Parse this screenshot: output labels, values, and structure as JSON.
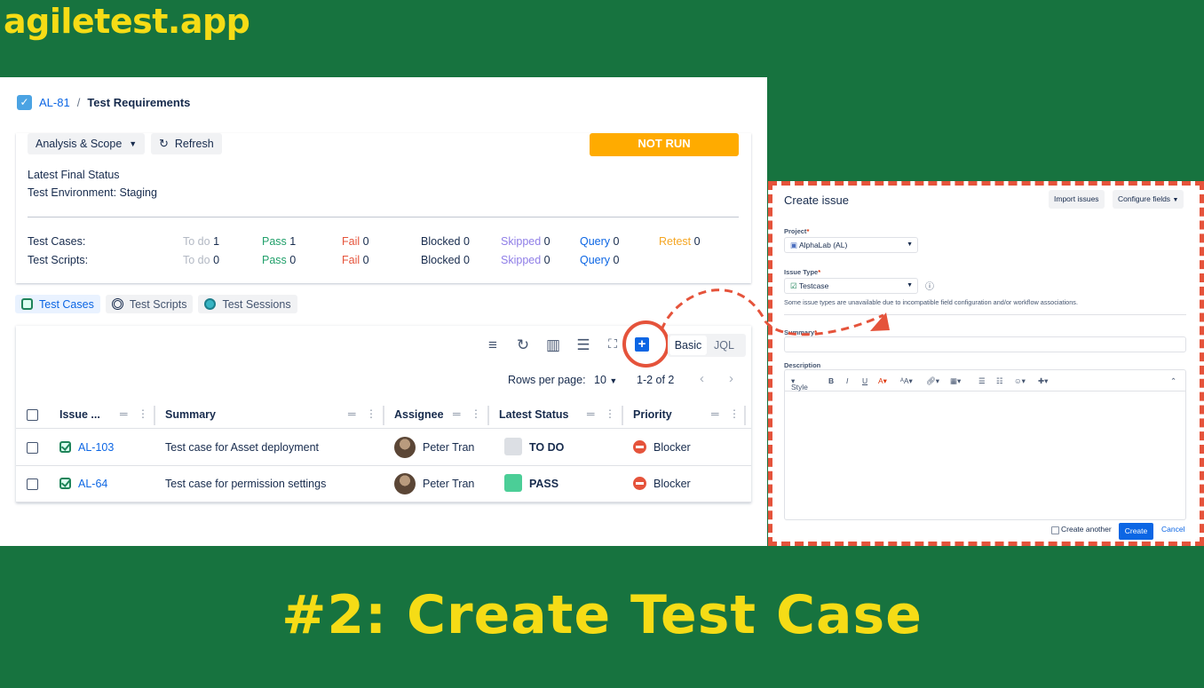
{
  "brand": "agiletest.app",
  "headline": "#2: Create Test Case",
  "breadcrumb": {
    "issue_key": "AL-81",
    "separator": "/",
    "title": "Test Requirements"
  },
  "summary_card": {
    "scope_button": "Analysis & Scope",
    "refresh_button": "Refresh",
    "status_badge": "NOT RUN",
    "final_status_label": "Latest Final Status",
    "environment": "Test Environment: Staging",
    "rows": [
      {
        "label": "Test Cases:",
        "todo_lbl": "To do",
        "todo": "1",
        "pass_lbl": "Pass",
        "pass": "1",
        "fail_lbl": "Fail",
        "fail": "0",
        "blocked_lbl": "Blocked",
        "blocked": "0",
        "skipped_lbl": "Skipped",
        "skipped": "0",
        "query_lbl": "Query",
        "query": "0",
        "retest_lbl": "Retest",
        "retest": "0"
      },
      {
        "label": "Test Scripts:",
        "todo_lbl": "To do",
        "todo": "0",
        "pass_lbl": "Pass",
        "pass": "0",
        "fail_lbl": "Fail",
        "fail": "0",
        "blocked_lbl": "Blocked",
        "blocked": "0",
        "skipped_lbl": "Skipped",
        "skipped": "0",
        "query_lbl": "Query",
        "query": "0"
      }
    ],
    "colors": {
      "todo": "#b3b9c4",
      "pass": "#22a06b",
      "fail": "#e5533b",
      "skipped": "#8f7ee7",
      "query": "#0c66e4",
      "retest": "#f5a623"
    }
  },
  "tabs": [
    {
      "label": "Test Cases",
      "icon": "check-icon"
    },
    {
      "label": "Test Scripts",
      "icon": "script-icon"
    },
    {
      "label": "Test Sessions",
      "icon": "session-icon"
    }
  ],
  "table": {
    "toolbar": {
      "basic": "Basic",
      "jql": "JQL"
    },
    "rows_per_page_label": "Rows per page:",
    "rows_per_page": "10",
    "range": "1-2 of 2",
    "columns": [
      "Issue ...",
      "Summary",
      "Assignee",
      "Latest Status",
      "Priority"
    ],
    "rows": [
      {
        "key": "AL-103",
        "summary": "Test case for Asset deployment",
        "assignee": "Peter Tran",
        "status": "TO DO",
        "status_color": "#dcdfe4",
        "priority": "Blocker"
      },
      {
        "key": "AL-64",
        "summary": "Test case for permission settings",
        "assignee": "Peter Tran",
        "status": "PASS",
        "status_color": "#4bce97",
        "priority": "Blocker"
      }
    ]
  },
  "dialog": {
    "title": "Create issue",
    "import_button": "Import issues",
    "configure_button": "Configure fields",
    "project_label": "Project",
    "project_value": "AlphaLab (AL)",
    "issue_type_label": "Issue Type",
    "issue_type_value": "Testcase",
    "note": "Some issue types are unavailable due to incompatible field configuration and/or workflow associations.",
    "summary_label": "Summary",
    "description_label": "Description",
    "editor_style": "Style",
    "create_another": "Create another",
    "create_button": "Create",
    "cancel_button": "Cancel"
  }
}
